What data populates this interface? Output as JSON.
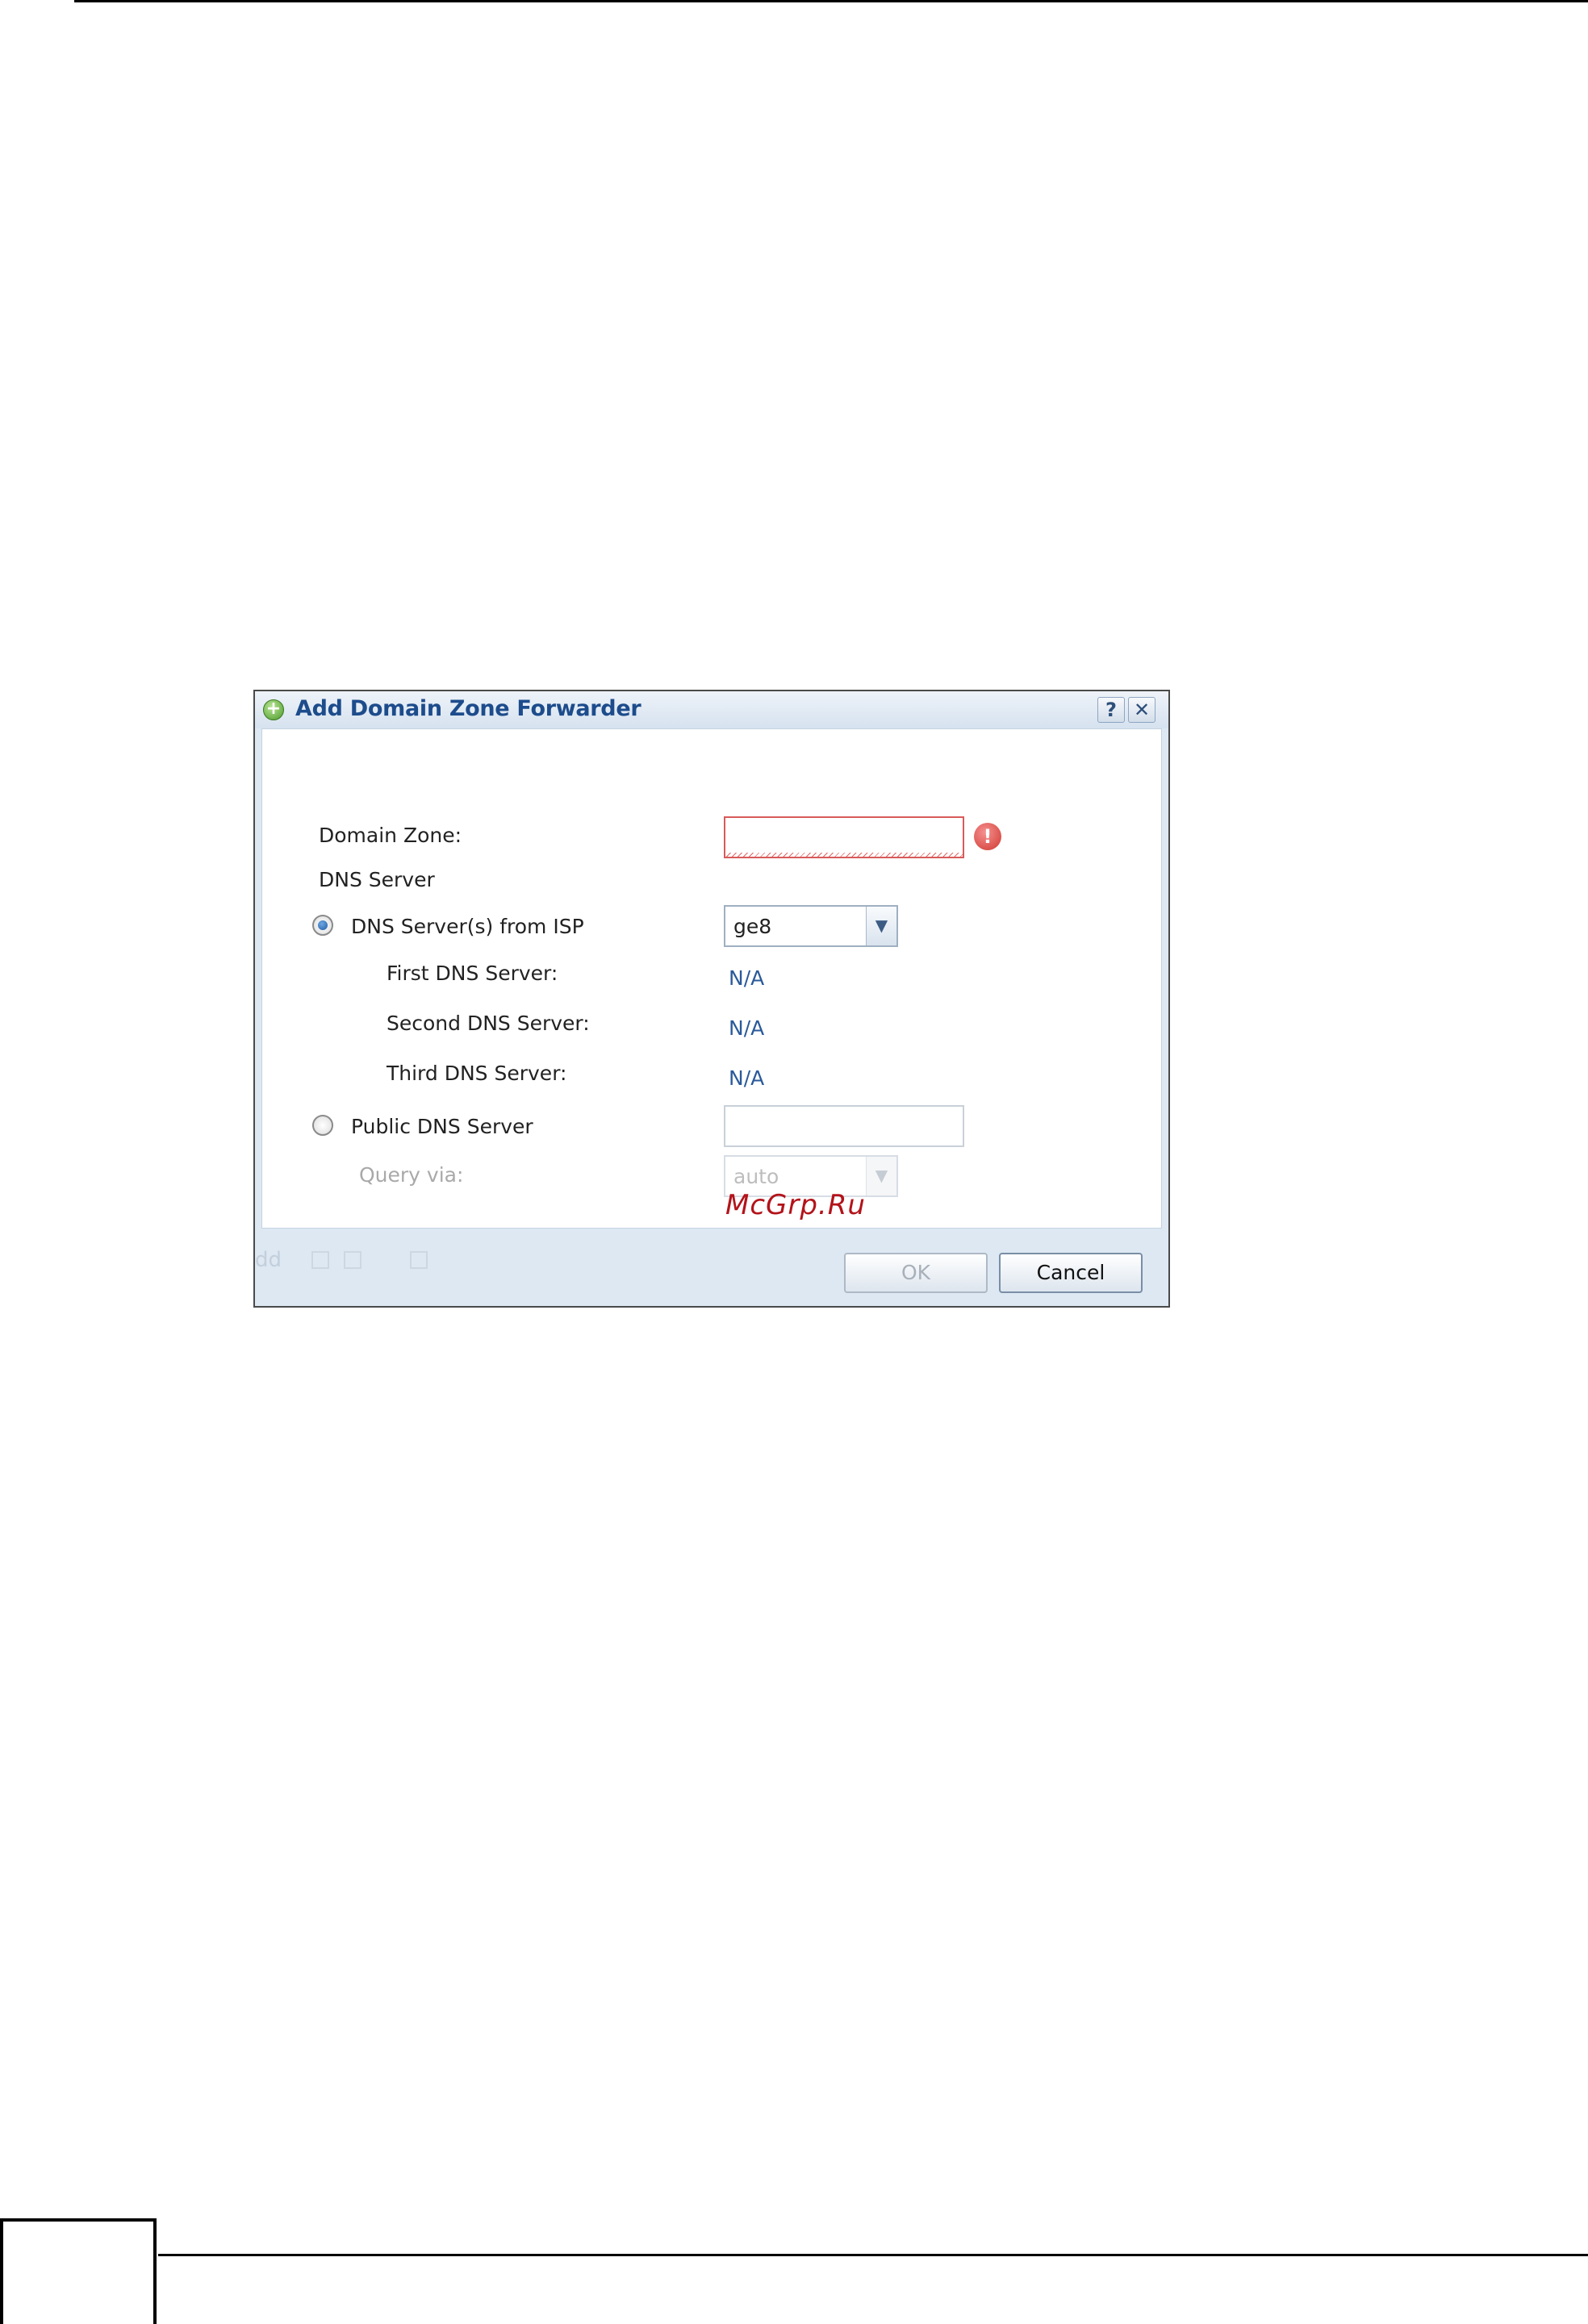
{
  "dialog": {
    "title": "Add Domain Zone Forwarder",
    "help_label": "?",
    "close_label": "✕",
    "domain_zone": {
      "label": "Domain Zone:",
      "value": ""
    },
    "dns_server_heading": "DNS Server",
    "dns_from_isp": {
      "label": "DNS Server(s) from ISP",
      "selected": true,
      "interface_value": "ge8",
      "first": {
        "label": "First DNS Server:",
        "value": "N/A"
      },
      "second": {
        "label": "Second DNS Server:",
        "value": "N/A"
      },
      "third": {
        "label": "Third DNS Server:",
        "value": "N/A"
      }
    },
    "public_dns": {
      "label": "Public DNS Server",
      "selected": false,
      "value": ""
    },
    "query_via": {
      "label": "Query via:",
      "value": "auto"
    },
    "footer_ghost_text": "dd",
    "ok_label": "OK",
    "cancel_label": "Cancel"
  },
  "watermark": "McGrp.Ru",
  "colors": {
    "title": "#1d4c8c",
    "value": "#2a5a9a",
    "error": "#d0382f",
    "watermark": "#b3131a"
  }
}
